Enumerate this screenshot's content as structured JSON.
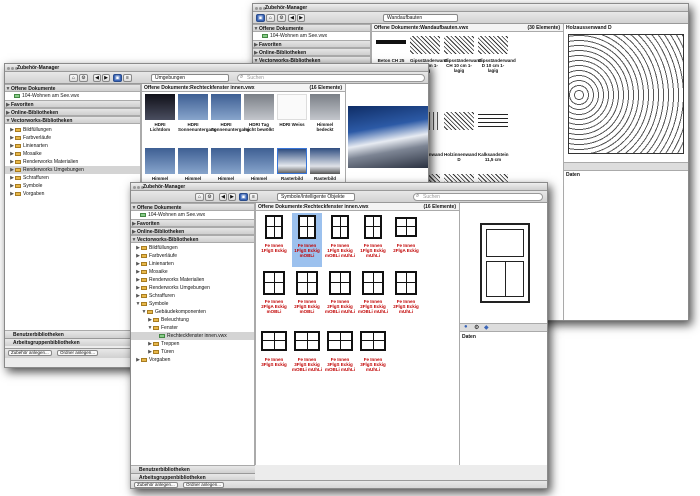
{
  "window_back": {
    "title": "Zubehör-Manager",
    "popup": "Wandaufbauten",
    "sidebar": [
      {
        "label": "Offene Dokumente",
        "type": "hdr"
      },
      {
        "label": "104-Wohnen am See.vwx",
        "type": "item"
      },
      {
        "label": "Favoriten",
        "type": "hdr"
      },
      {
        "label": "Online-Bibliotheken",
        "type": "hdr"
      },
      {
        "label": "Vectorworks-Bibliotheken",
        "type": "hdr"
      }
    ],
    "content_header": "Offene Dokumente:Wandaufbauten.vwx",
    "content_count": "(30 Elemente)",
    "items": [
      "Beton CH 25 cm",
      "Gipsständerwand CH 10 cm 1-lagig",
      "Gipsständerwand CH 10 cm 1-lagig",
      "Gipsständerwand D 10 cm 1-lagig",
      "Holzaussenwand D",
      "Holzinnenwand CH",
      "Holzinnenwand D",
      "Kalksandstein 11,5 cm",
      "Kalksandst",
      "Kalksandst",
      "Kalksandst"
    ],
    "preview_title": "Holzaussenwand D",
    "daten_label": "Daten"
  },
  "window_mid": {
    "title": "Zubehör-Manager",
    "popup": "Umgebungen",
    "search": "Suchen",
    "sidebar": [
      {
        "label": "Offene Dokumente",
        "type": "hdr"
      },
      {
        "label": "104-Wohnen am See.vwx",
        "type": "item"
      },
      {
        "label": "Favoriten",
        "type": "hdr"
      },
      {
        "label": "Online-Bibliotheken",
        "type": "hdr"
      },
      {
        "label": "Vectorworks-Bibliotheken",
        "type": "hdr"
      },
      {
        "label": "Bildfüllungen",
        "type": "sub"
      },
      {
        "label": "Farbverläufe",
        "type": "sub"
      },
      {
        "label": "Linienarten",
        "type": "sub"
      },
      {
        "label": "Mosaike",
        "type": "sub"
      },
      {
        "label": "Renderworks Materialien",
        "type": "sub"
      },
      {
        "label": "Renderworks Umgebungen",
        "type": "subsel"
      },
      {
        "label": "Schraffuren",
        "type": "sub"
      },
      {
        "label": "Symbole",
        "type": "sub"
      },
      {
        "label": "Vorgaben",
        "type": "sub"
      }
    ],
    "content_header": "Offene Dokumente:Rechteckfenster innen.vwx",
    "content_count": "(16 Elemente)",
    "items": [
      "HDRI Lichtdom",
      "HDRI Sonnenuntergang",
      "HDRI Sonnenuntergang",
      "HDRI Tag leicht bewölkt",
      "HDRI Weiss",
      "Himmel bedeckt",
      "Himmel",
      "Himmel",
      "Himmel",
      "Himmel",
      "Rasterbild",
      "Rasterbild"
    ],
    "footer_left": "Benutzerbibliotheken",
    "footer_left2": "Arbeitsgruppenbibliotheken",
    "btn1": "Zubehör anlegen...",
    "btn2": "Ordner anlegen..."
  },
  "window_front": {
    "title": "Zubehör-Manager",
    "popup": "Symbole/Intelligente Objekte",
    "search": "Suchen",
    "sidebar": [
      {
        "label": "Offene Dokumente",
        "type": "hdr"
      },
      {
        "label": "104-Wohnen am See.vwx",
        "type": "item"
      },
      {
        "label": "Favoriten",
        "type": "hdr"
      },
      {
        "label": "Online-Bibliotheken",
        "type": "hdr"
      },
      {
        "label": "Vectorworks-Bibliotheken",
        "type": "hdr"
      },
      {
        "label": "Bildfüllungen",
        "type": "sub"
      },
      {
        "label": "Farbverläufe",
        "type": "sub"
      },
      {
        "label": "Linienarten",
        "type": "sub"
      },
      {
        "label": "Mosaike",
        "type": "sub"
      },
      {
        "label": "Renderworks Materialien",
        "type": "sub"
      },
      {
        "label": "Renderworks Umgebungen",
        "type": "sub"
      },
      {
        "label": "Schraffuren",
        "type": "sub"
      },
      {
        "label": "Symbole",
        "type": "sub"
      },
      {
        "label": "Gebäudekomponenten",
        "type": "sub2"
      },
      {
        "label": "Beleuchtung",
        "type": "sub3"
      },
      {
        "label": "Fenster",
        "type": "sub3"
      },
      {
        "label": "Rechteckfenster innen.vwx",
        "type": "sel"
      },
      {
        "label": "Treppen",
        "type": "sub3"
      },
      {
        "label": "Türen",
        "type": "sub3"
      },
      {
        "label": "Vorgaben",
        "type": "sub"
      }
    ],
    "content_header": "Offene Dokumente:Rechteckfenster innen.vwx",
    "content_count": "(16 Elemente)",
    "rows": [
      [
        "Fe Innen 1FlgS Eckig",
        "Fe Innen 1FlgS Eckig mOBLi",
        "Fe Innen 1FlgS Eckig mOBLi mUhLi",
        "Fe Innen 1FlgS Eckig mUhLi",
        "Fe Innen 2FlgA Eckig"
      ],
      [
        "Fe Innen 2FlgA Eckig mOBLi",
        "Fe Innen 2FlgS Eckig mOBLi",
        "Fe Innen 2FlgS Eckig mOBLi mUhLi",
        "Fe Innen 2FlgS Eckig mOBLi mUhLi",
        "Fe Innen 2FlgS Eckig mUhLi"
      ],
      [
        "Fe Innen 3FlgS Eckig",
        "Fe Innen 3FlgS Eckig mOBLi mUhLi",
        "Fe Innen 3FlgS Eckig mOBLi mUhLi",
        "Fe Innen 3FlgS Eckig mUhLi"
      ]
    ],
    "daten_label": "Daten",
    "footer_left": "Benutzerbibliotheken",
    "footer_left2": "Arbeitsgruppenbibliotheken",
    "btn1": "Zubehör anlegen...",
    "btn2": "Ordner anlegen..."
  }
}
